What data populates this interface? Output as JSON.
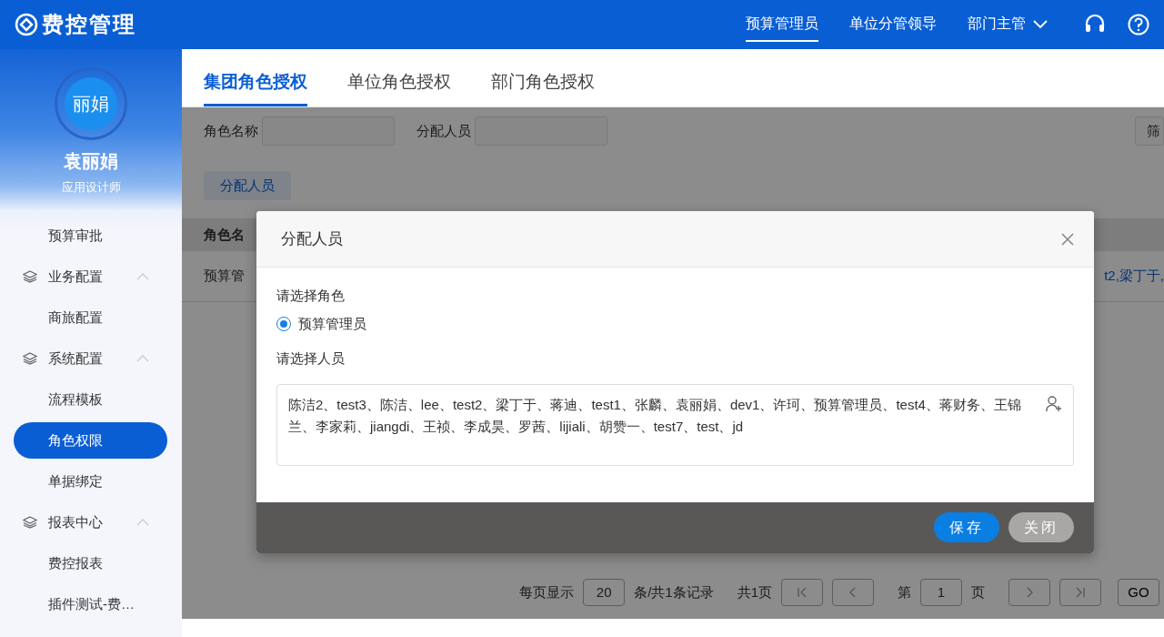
{
  "app": {
    "title": "费控管理"
  },
  "roles": [
    {
      "label": "预算管理员",
      "selected": true
    },
    {
      "label": "单位分管领导",
      "selected": false
    },
    {
      "label": "部门主管",
      "selected": false
    }
  ],
  "user": {
    "avatar_text": "丽娟",
    "name": "袁丽娟",
    "role": "应用设计师"
  },
  "sidebar": {
    "items": [
      {
        "kind": "item",
        "label": "预算审批",
        "selected": false
      },
      {
        "kind": "group",
        "label": "业务配置",
        "expanded": true,
        "children": [
          {
            "kind": "item",
            "label": "商旅配置",
            "selected": false
          }
        ]
      },
      {
        "kind": "group",
        "label": "系统配置",
        "expanded": true,
        "children": [
          {
            "kind": "item",
            "label": "流程模板",
            "selected": false
          },
          {
            "kind": "item",
            "label": "角色权限",
            "selected": true
          },
          {
            "kind": "item",
            "label": "单据绑定",
            "selected": false
          }
        ]
      },
      {
        "kind": "group",
        "label": "报表中心",
        "expanded": true,
        "children": [
          {
            "kind": "item",
            "label": "费控报表",
            "selected": false
          },
          {
            "kind": "item",
            "label": "插件测试-费…",
            "selected": false
          }
        ]
      }
    ]
  },
  "tabs": [
    {
      "label": "集团角色授权",
      "selected": true
    },
    {
      "label": "单位角色授权",
      "selected": false
    },
    {
      "label": "部门角色授权",
      "selected": false
    }
  ],
  "filters": [
    {
      "label": "角色名称"
    },
    {
      "label": "分配人员"
    }
  ],
  "filter_button": "筛",
  "assign_button": "分配人员",
  "table": {
    "columns": [
      "角色名"
    ],
    "rows": [
      [
        "预算管",
        "t2,梁丁于,"
      ]
    ]
  },
  "pagination": {
    "per_page_label": "每页显示",
    "per_page": "20",
    "records": "条/共1条记录",
    "pages": "共1页",
    "page_prefix": "第",
    "page": "1",
    "page_suffix": "页",
    "go": "GO"
  },
  "dialog": {
    "title": "分配人员",
    "role_label": "请选择角色",
    "role_options": [
      {
        "label": "预算管理员",
        "selected": true
      }
    ],
    "people_label": "请选择人员",
    "people": "陈洁2、test3、陈洁、lee、test2、梁丁于、蒋迪、test1、张麟、袁丽娟、dev1、许珂、预算管理员、test4、蒋财务、王锦兰、李家莉、jiangdi、王祯、李成昊、罗茜、lijiali、胡赞一、test7、test、jd",
    "buttons": [
      {
        "label": "保存",
        "kind": "primary"
      },
      {
        "label": "关闭",
        "kind": "secondary"
      }
    ]
  }
}
